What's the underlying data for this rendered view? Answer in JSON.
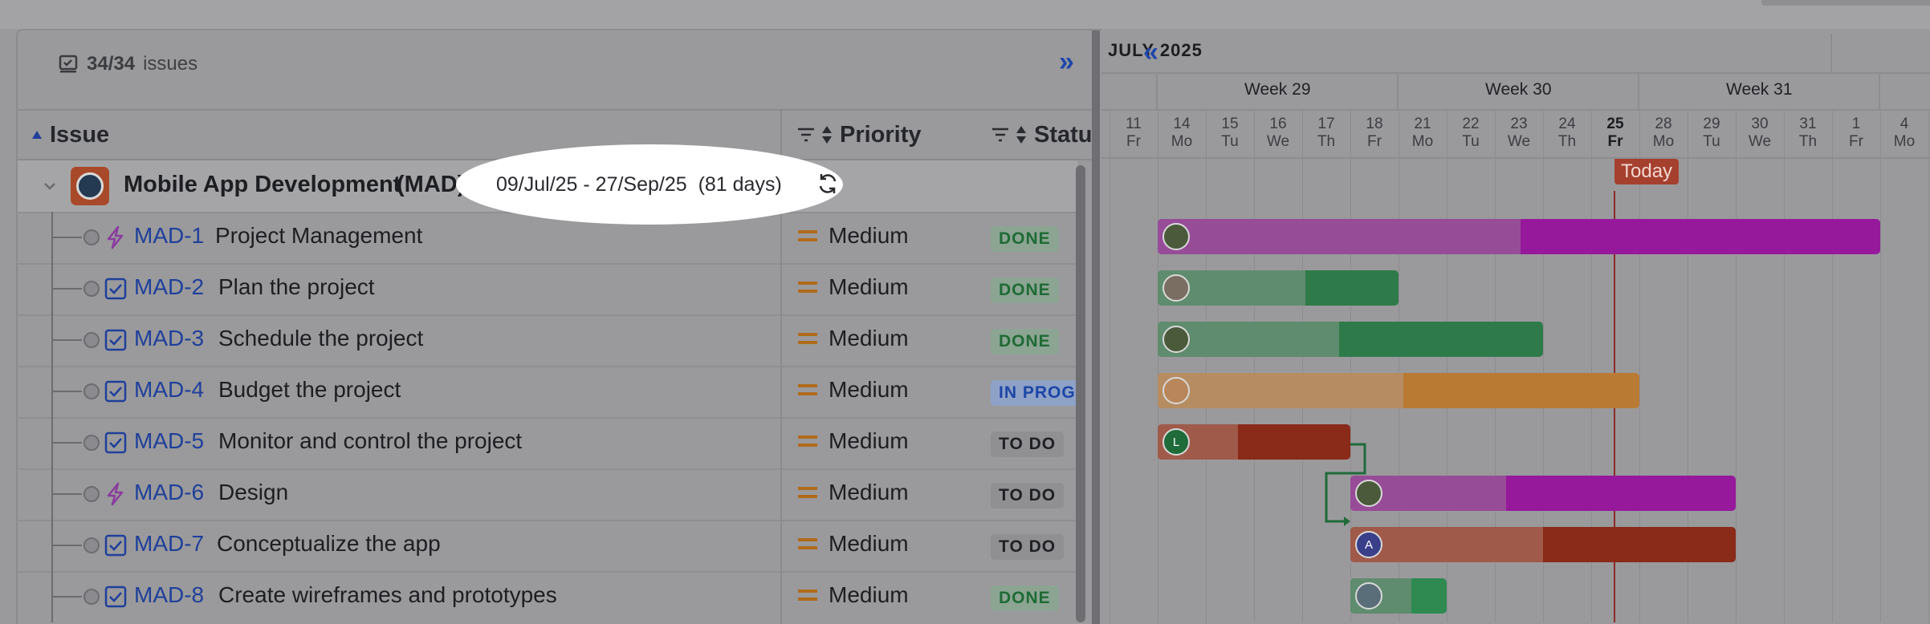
{
  "toolbar": {
    "issue_count_bold": "34/34",
    "issue_count_label": "issues",
    "collapse_symbol": "»"
  },
  "columns": {
    "issue": "Issue",
    "priority": "Priority",
    "status": "Statu"
  },
  "project": {
    "name": "Mobile App Development",
    "key": "(MAD)",
    "dates": "09/Jul/25 - 27/Sep/25",
    "duration": "(81 days)"
  },
  "issues": [
    {
      "key": "MAD-1",
      "summary": "Project Management",
      "type": "epic",
      "priority": "Medium",
      "status": "DONE"
    },
    {
      "key": "MAD-2",
      "summary": "Plan the project",
      "type": "task",
      "priority": "Medium",
      "status": "DONE"
    },
    {
      "key": "MAD-3",
      "summary": "Schedule the project",
      "type": "task",
      "priority": "Medium",
      "status": "DONE"
    },
    {
      "key": "MAD-4",
      "summary": "Budget the project",
      "type": "task",
      "priority": "Medium",
      "status": "IN PROG"
    },
    {
      "key": "MAD-5",
      "summary": "Monitor and control the project",
      "type": "task",
      "priority": "Medium",
      "status": "TO DO"
    },
    {
      "key": "MAD-6",
      "summary": "Design",
      "type": "epic",
      "priority": "Medium",
      "status": "TO DO"
    },
    {
      "key": "MAD-7",
      "summary": "Conceptualize the app",
      "type": "task",
      "priority": "Medium",
      "status": "TO DO"
    },
    {
      "key": "MAD-8",
      "summary": "Create wireframes and prototypes",
      "type": "task",
      "priority": "Medium",
      "status": "DONE"
    }
  ],
  "timeline": {
    "month": "JULY 2025",
    "nav_symbol": "«",
    "weeks": [
      "Week 29",
      "Week 30",
      "Week 31"
    ],
    "days": [
      {
        "num": "11",
        "dow": "Fr"
      },
      {
        "num": "14",
        "dow": "Mo"
      },
      {
        "num": "15",
        "dow": "Tu"
      },
      {
        "num": "16",
        "dow": "We"
      },
      {
        "num": "17",
        "dow": "Th"
      },
      {
        "num": "18",
        "dow": "Fr"
      },
      {
        "num": "21",
        "dow": "Mo"
      },
      {
        "num": "22",
        "dow": "Tu"
      },
      {
        "num": "23",
        "dow": "We"
      },
      {
        "num": "24",
        "dow": "Th"
      },
      {
        "num": "25",
        "dow": "Fr"
      },
      {
        "num": "28",
        "dow": "Mo"
      },
      {
        "num": "29",
        "dow": "Tu"
      },
      {
        "num": "30",
        "dow": "We"
      },
      {
        "num": "31",
        "dow": "Th"
      },
      {
        "num": "1",
        "dow": "Fr"
      },
      {
        "num": "4",
        "dow": "Mo"
      }
    ],
    "today_label": "Today",
    "avatar_letters": {
      "mad5": "L",
      "mad7": "A"
    }
  },
  "colors": {
    "epic": "#96199b",
    "done": "#2f7a4a",
    "inprog": "#b97a34",
    "todo": "#8a2a18",
    "link": "#1f3f9a"
  }
}
